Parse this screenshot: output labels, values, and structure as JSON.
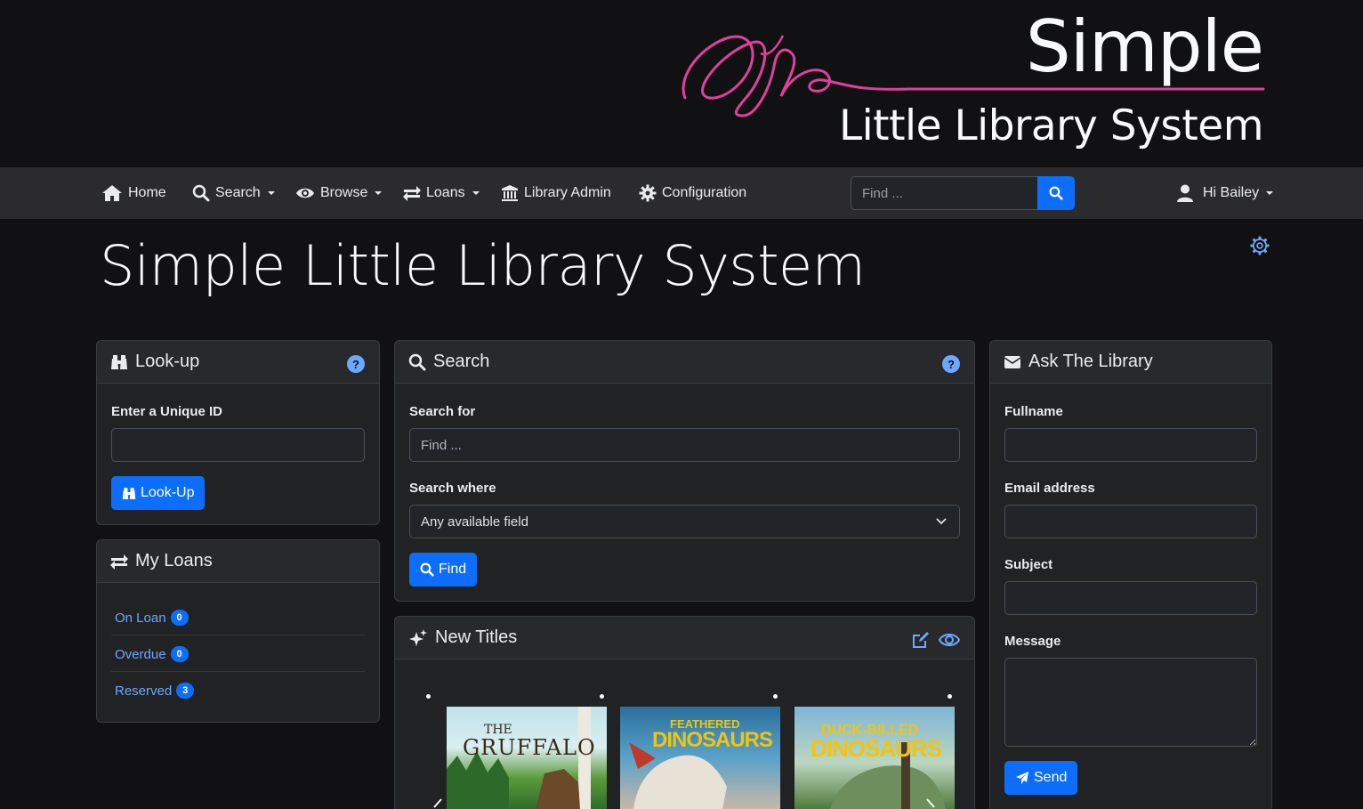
{
  "banner": {
    "logo_title": "Simple",
    "logo_subtitle": "Little Library System"
  },
  "navbar": {
    "items": [
      {
        "label": "Home",
        "icon": "home-icon",
        "dropdown": false
      },
      {
        "label": "Search",
        "icon": "search-icon",
        "dropdown": true
      },
      {
        "label": "Browse",
        "icon": "eye-icon",
        "dropdown": true
      },
      {
        "label": "Loans",
        "icon": "exchange-icon",
        "dropdown": true
      },
      {
        "label": "Library Admin",
        "icon": "institution-icon",
        "dropdown": false
      },
      {
        "label": "Configuration",
        "icon": "gear-icon",
        "dropdown": false
      }
    ],
    "find_placeholder": "Find ...",
    "user_label": "Hi Bailey"
  },
  "page": {
    "title": "Simple Little Library System"
  },
  "lookup": {
    "title": "Look-up",
    "field_label": "Enter a Unique ID",
    "field_value": "",
    "button_label": "Look-Up"
  },
  "loans": {
    "title": "My Loans",
    "items": [
      {
        "label": "On Loan",
        "count": "0"
      },
      {
        "label": "Overdue",
        "count": "0"
      },
      {
        "label": "Reserved",
        "count": "3"
      }
    ]
  },
  "search": {
    "title": "Search",
    "for_label": "Search for",
    "for_placeholder": "Find ...",
    "where_label": "Search where",
    "where_selected": "Any available field",
    "button_label": "Find"
  },
  "new_titles": {
    "title": "New Titles",
    "books": [
      {
        "line1": "THE",
        "line2": "GRUFFALO"
      },
      {
        "line1": "FEATHERED",
        "line2": "DINOSAURS"
      },
      {
        "line1": "DUCK-BILLED",
        "line2": "DINOSAURS"
      }
    ]
  },
  "ask": {
    "title": "Ask The Library",
    "fullname_label": "Fullname",
    "email_label": "Email address",
    "subject_label": "Subject",
    "message_label": "Message",
    "button_label": "Send"
  },
  "colors": {
    "primary": "#0d6efd",
    "link": "#6ea8fe",
    "logo_accent": "#e0409a"
  }
}
